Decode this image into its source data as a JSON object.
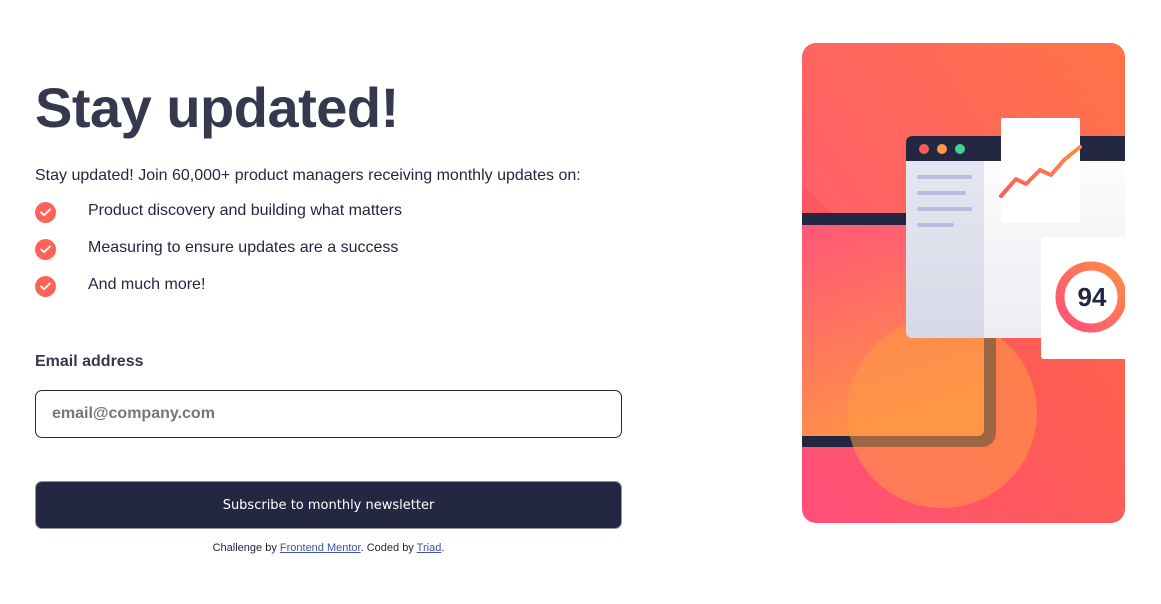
{
  "colors": {
    "tomato": "#ff6257",
    "dark_slate_grey": "#242742",
    "charcoal_grey": "#36384e",
    "grey": "#9294a0",
    "white": "#ffffff"
  },
  "signup": {
    "title": "Stay updated!",
    "intro": "Stay updated! Join 60,000+ product managers receiving monthly updates on:",
    "benefits": [
      {
        "icon": "check-circle-icon",
        "label": "Product discovery and building what matters"
      },
      {
        "icon": "check-circle-icon",
        "label": "Measuring to ensure updates are a success"
      },
      {
        "icon": "check-circle-icon",
        "label": "And much more!"
      }
    ],
    "email_label": "Email address",
    "email_placeholder": "email@company.com",
    "email_value": "",
    "submit_label": "Subscribe to monthly newsletter"
  },
  "attribution": {
    "prefix": "Challenge by",
    "challenge_link": "Frontend Mentor",
    "middle": ". Coded by",
    "author_link": "Triad",
    "suffix": "."
  },
  "illustration": {
    "score": "94"
  }
}
